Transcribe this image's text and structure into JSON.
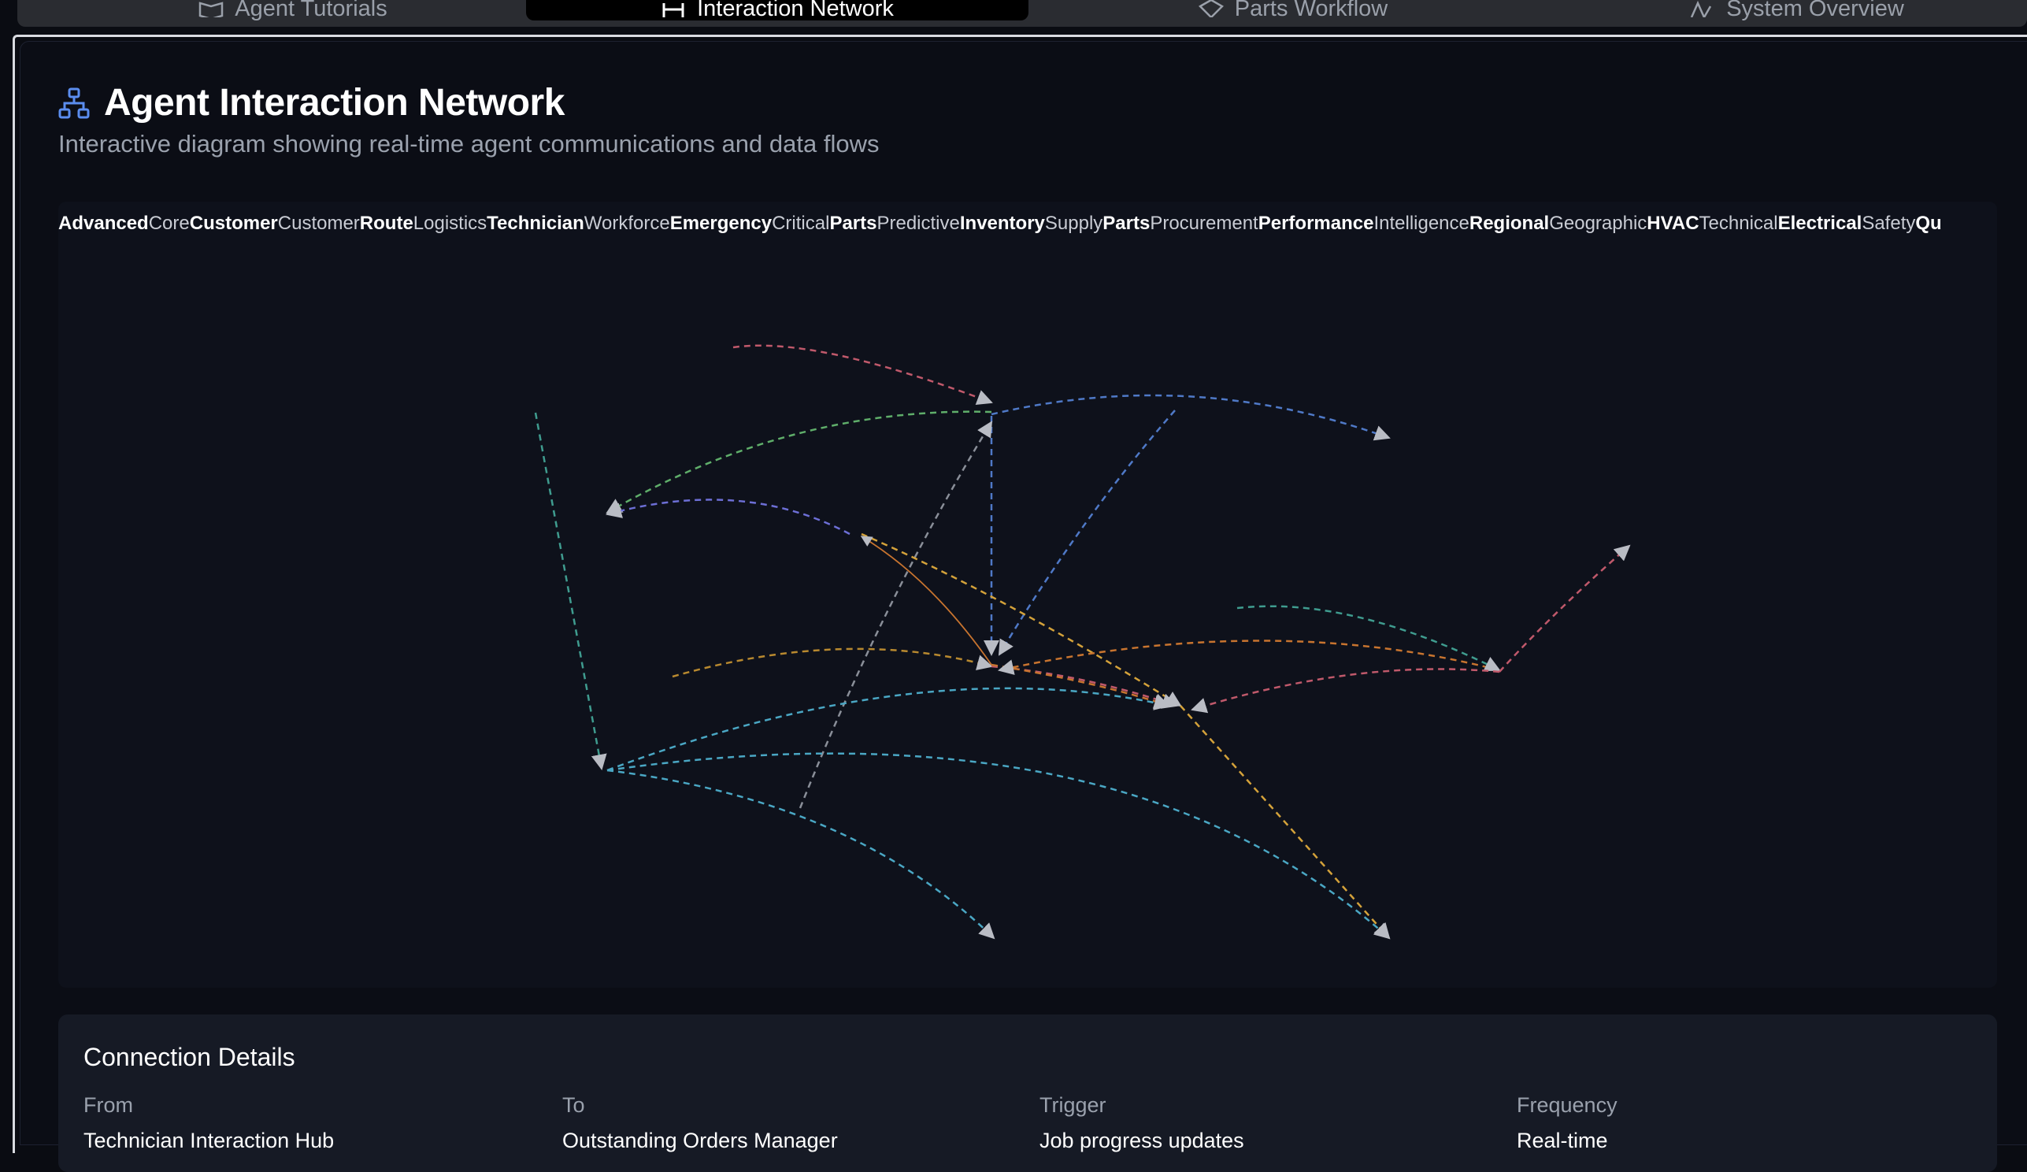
{
  "tabs": [
    {
      "label": "Agent Tutorials",
      "icon": "book-icon",
      "active": false
    },
    {
      "label": "Interaction Network",
      "icon": "network-icon",
      "active": true
    },
    {
      "label": "Parts Workflow",
      "icon": "package-icon",
      "active": false
    },
    {
      "label": "System Overview",
      "icon": "activity-icon",
      "active": false
    }
  ],
  "header": {
    "title": "Agent Interaction Network",
    "subtitle": "Interactive diagram showing real-time agent communications and data flows",
    "icon": "network-icon",
    "icon_color": "#5b8def"
  },
  "legend": [
    {
      "bold": "Advanced",
      "normal": "Core"
    },
    {
      "bold": "Customer",
      "normal": "Customer"
    },
    {
      "bold": "Route",
      "normal": "Logistics"
    },
    {
      "bold": "Technician",
      "normal": "Workforce"
    },
    {
      "bold": "Emergency",
      "normal": "Critical"
    },
    {
      "bold": "Parts",
      "normal": "Predictive"
    },
    {
      "bold": "Inventory",
      "normal": "Supply"
    },
    {
      "bold": "Parts",
      "normal": "Procurement"
    },
    {
      "bold": "Performance",
      "normal": "Intelligence"
    },
    {
      "bold": "Regional",
      "normal": "Geographic"
    },
    {
      "bold": "HVAC",
      "normal": "Technical"
    },
    {
      "bold": "Electrical",
      "normal": "Safety"
    },
    {
      "bold": "Qu",
      "normal": ""
    }
  ],
  "details": {
    "title": "Connection Details",
    "from_label": "From",
    "from_value": "Technician Interaction Hub",
    "to_label": "To",
    "to_value": "Outstanding Orders Manager",
    "trigger_label": "Trigger",
    "trigger_value": "Job progress updates",
    "frequency_label": "Frequency",
    "frequency_value": "Real-time"
  }
}
